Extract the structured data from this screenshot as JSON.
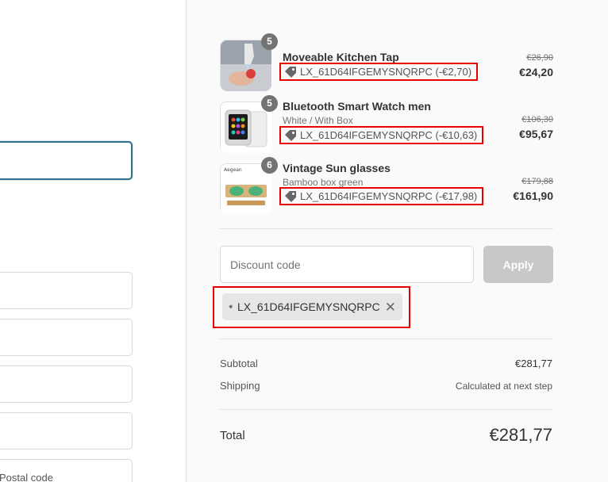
{
  "left": {
    "postal_code_label": "Postal code"
  },
  "products": [
    {
      "name": "Moveable Kitchen Tap",
      "variant": "",
      "quantity": "5",
      "discount": "LX_61D64IFGEMYSNQRPC (-€2,70)",
      "old_price": "€26,90",
      "price": "€24,20",
      "icon": "faucet-image"
    },
    {
      "name": "Bluetooth Smart Watch men",
      "variant": "White / With Box",
      "quantity": "5",
      "discount": "LX_61D64IFGEMYSNQRPC (-€10,63)",
      "old_price": "€106,30",
      "price": "€95,67",
      "icon": "smartwatch-image"
    },
    {
      "name": "Vintage Sun glasses",
      "variant": "Bamboo box green",
      "quantity": "6",
      "discount": "LX_61D64IFGEMYSNQRPC (-€17,98)",
      "old_price": "€179,88",
      "price": "€161,90",
      "icon": "sunglasses-image"
    }
  ],
  "discount": {
    "placeholder": "Discount code",
    "apply_label": "Apply",
    "applied_code": "LX_61D64IFGEMYSNQRPC"
  },
  "summary": {
    "subtotal_label": "Subtotal",
    "subtotal_value": "€281,77",
    "shipping_label": "Shipping",
    "shipping_value": "Calculated at next step",
    "total_label": "Total",
    "total_value": "€281,77"
  },
  "colors": {
    "highlight": "#e60000",
    "focus_border": "#2f6f8f",
    "apply_disabled": "#c8c8c8"
  }
}
